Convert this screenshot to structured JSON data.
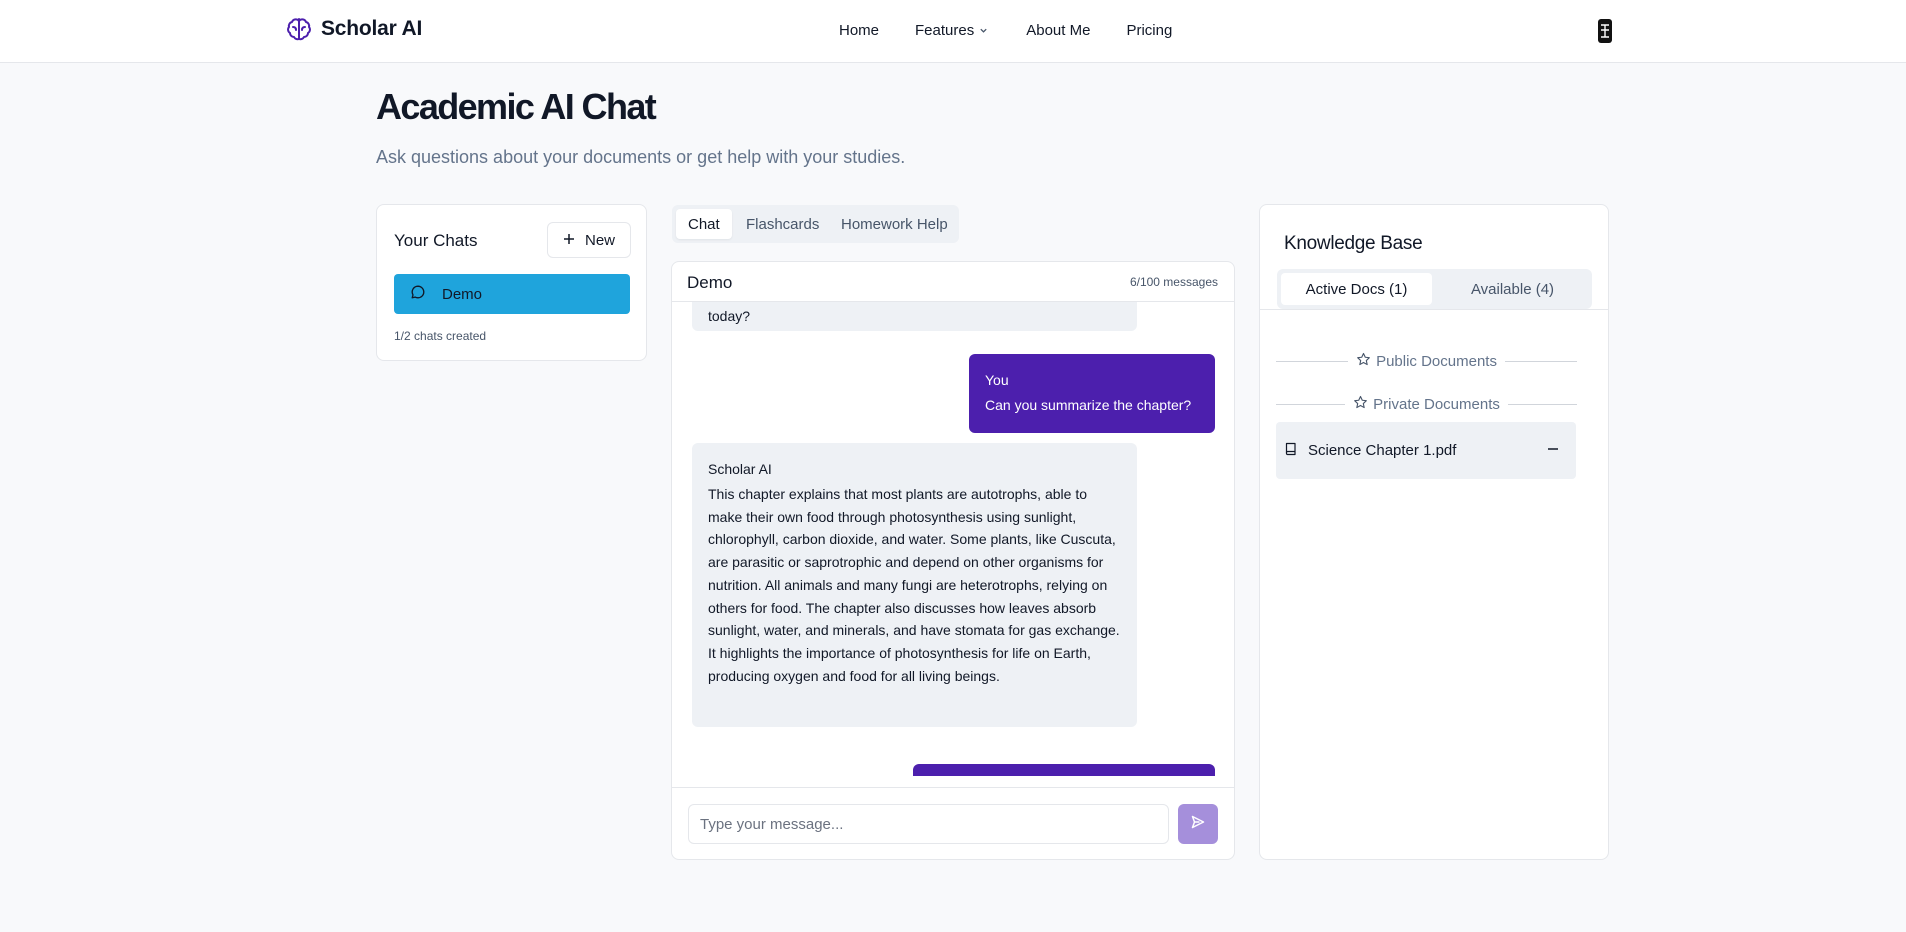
{
  "nav": {
    "brand": "Scholar AI",
    "links": [
      "Home",
      "Features",
      "About Me",
      "Pricing"
    ]
  },
  "header": {
    "title": "Academic AI Chat",
    "subtitle": "Ask questions about your documents or get help with your studies."
  },
  "chats": {
    "title": "Your Chats",
    "new_label": "New",
    "items": [
      {
        "label": "Demo"
      }
    ],
    "count_text": "1/2 chats created"
  },
  "tabs": [
    "Chat",
    "Flashcards",
    "Homework Help"
  ],
  "chat": {
    "name": "Demo",
    "message_count": "6/100 messages",
    "messages": [
      {
        "sender": "",
        "text": "today?"
      },
      {
        "sender": "You",
        "text": "Can you summarize the chapter?"
      },
      {
        "sender": "Scholar AI",
        "text": "This chapter explains that most plants are autotrophs, able to make their own food through photosynthesis using sunlight, chlorophyll, carbon dioxide, and water. Some plants, like Cuscuta, are parasitic or saprotrophic and depend on other organisms for nutrition. All animals and many fungi are heterotrophs, relying on others for food. The chapter also discusses how leaves absorb sunlight, water, and minerals, and have stomata for gas exchange. It highlights the importance of photosynthesis for life on Earth, producing oxygen and food for all living beings."
      }
    ],
    "input_placeholder": "Type your message..."
  },
  "kb": {
    "title": "Knowledge Base",
    "tabs": [
      "Active Docs (1)",
      "Available (4)"
    ],
    "public_label": "Public Documents",
    "private_label": "Private Documents",
    "docs": [
      {
        "name": "Science Chapter 1.pdf"
      }
    ]
  },
  "colors": {
    "accent_purple": "#4c1fad",
    "chat_active": "#1fa4dc",
    "send_button": "#a58fdb"
  },
  "icons": [
    "brain-icon",
    "chevron-down-icon",
    "avatar-icon",
    "plus-icon",
    "message-icon",
    "send-icon",
    "star-icon",
    "book-icon",
    "minus-icon"
  ]
}
